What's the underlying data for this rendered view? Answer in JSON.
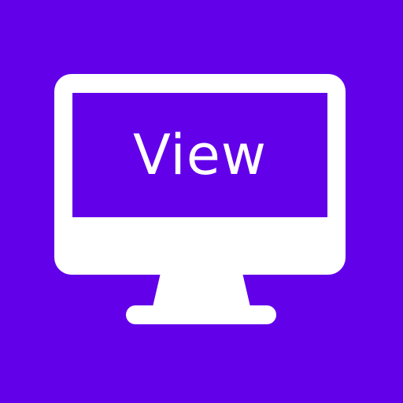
{
  "icon": {
    "name": "monitor-icon",
    "label": "View",
    "background_color": "#6200EA",
    "foreground_color": "#FFFFFF"
  }
}
